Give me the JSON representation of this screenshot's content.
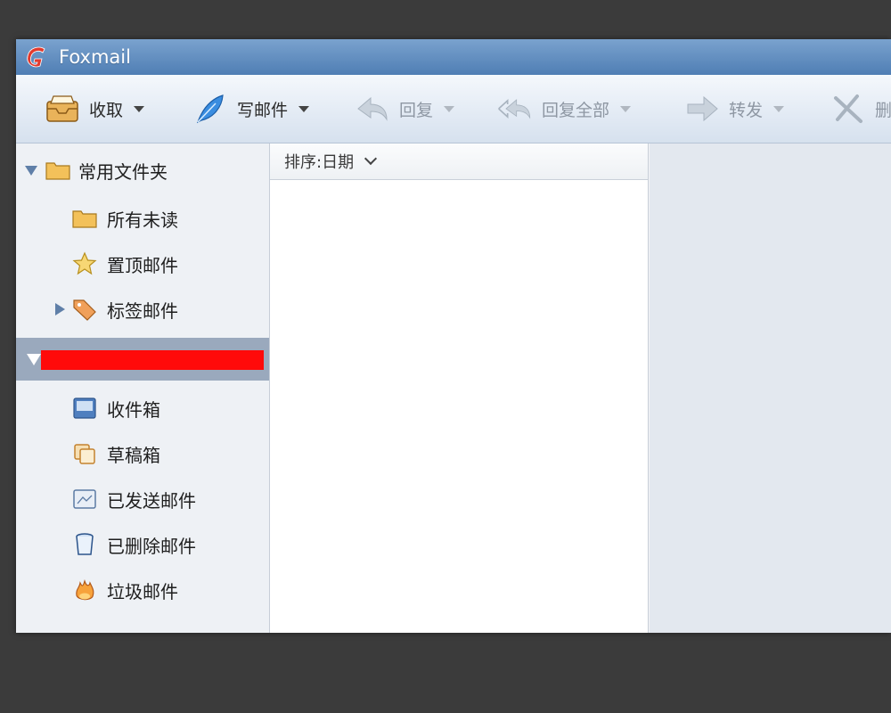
{
  "window": {
    "title": "Foxmail"
  },
  "toolbar": {
    "receive_label": "收取",
    "compose_label": "写邮件",
    "reply_label": "回复",
    "reply_all_label": "回复全部",
    "forward_label": "转发",
    "delete_label": "删"
  },
  "sidebar": {
    "common_folder": "常用文件夹",
    "items": [
      {
        "label": "所有未读",
        "icon": "folder-icon"
      },
      {
        "label": "置顶邮件",
        "icon": "star-icon"
      },
      {
        "label": "标签邮件",
        "icon": "tag-icon"
      }
    ],
    "account_items": [
      {
        "label": "收件箱",
        "icon": "inbox-icon"
      },
      {
        "label": "草稿箱",
        "icon": "drafts-icon"
      },
      {
        "label": "已发送邮件",
        "icon": "sent-icon"
      },
      {
        "label": "已删除邮件",
        "icon": "trash-icon"
      },
      {
        "label": "垃圾邮件",
        "icon": "spam-icon"
      }
    ]
  },
  "message_list": {
    "sort_label": "排序:日期"
  },
  "colors": {
    "titlebar": "#4f7eb4",
    "redaction": "#ff0a0a",
    "selected_row": "#9aa9bd"
  }
}
